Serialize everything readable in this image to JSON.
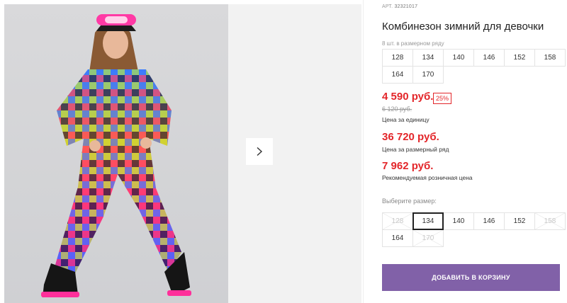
{
  "product": {
    "sku_label": "АРТ.",
    "sku": "32321017",
    "title": "Комбинезон зимний для девочки",
    "count_note": "8 шт. в размерном ряду",
    "size_range": [
      "128",
      "134",
      "140",
      "146",
      "152",
      "158",
      "164",
      "170"
    ]
  },
  "pricing": {
    "unit_price": "4 590 руб.",
    "discount": "25%",
    "old_price": "6 120 руб.",
    "unit_caption": "Цена за единицу",
    "range_price": "36 720 руб.",
    "range_caption": "Цена за размерный ряд",
    "retail_price": "7 962 руб.",
    "retail_caption": "Рекомендуемая розничная цена"
  },
  "size_picker": {
    "label": "Выберите размер:",
    "sizes": [
      {
        "label": "128",
        "state": "disabled"
      },
      {
        "label": "134",
        "state": "selected"
      },
      {
        "label": "140",
        "state": "available"
      },
      {
        "label": "146",
        "state": "available"
      },
      {
        "label": "152",
        "state": "available"
      },
      {
        "label": "158",
        "state": "disabled"
      },
      {
        "label": "164",
        "state": "available"
      },
      {
        "label": "170",
        "state": "disabled"
      }
    ]
  },
  "actions": {
    "add_to_cart": "ДОБАВИТЬ В КОРЗИНУ"
  },
  "colors": {
    "price_red": "#e3262a",
    "button_purple": "#8161a8"
  },
  "icons": {
    "next": "chevron-right-icon"
  }
}
